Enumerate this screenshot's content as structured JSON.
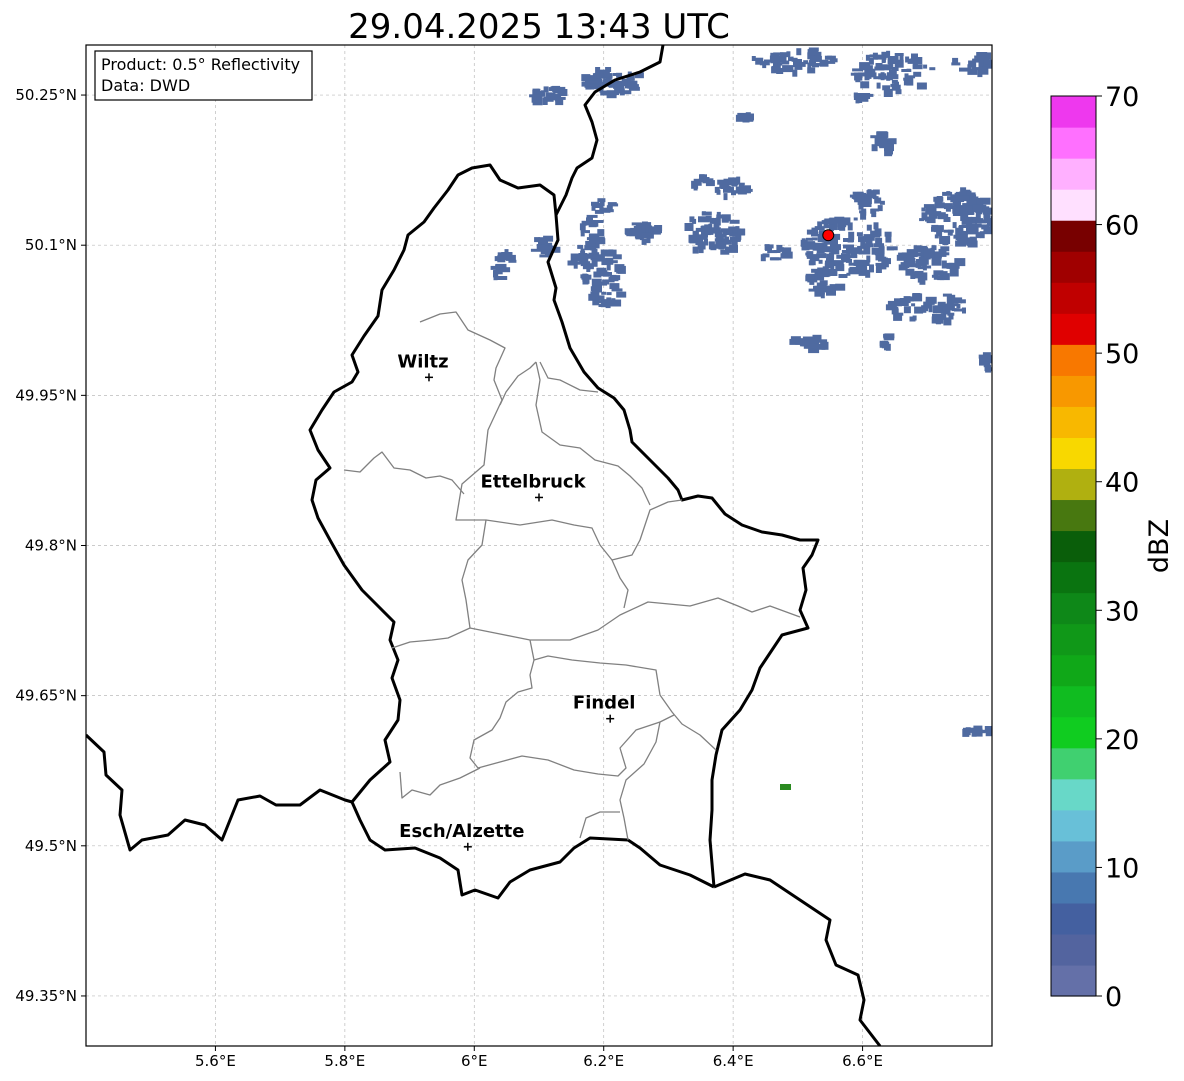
{
  "map": {
    "title": "29.04.2025 13:43 UTC",
    "info": {
      "line1": "Product: 0.5° Reflectivity",
      "line2": "Data: DWD"
    },
    "lon_range": [
      5.4,
      6.8
    ],
    "lat_range": [
      49.3,
      50.3
    ],
    "lon_ticks": [
      {
        "value": 5.6,
        "label": "5.6°E"
      },
      {
        "value": 5.8,
        "label": "5.8°E"
      },
      {
        "value": 6.0,
        "label": "6°E"
      },
      {
        "value": 6.2,
        "label": "6.2°E"
      },
      {
        "value": 6.4,
        "label": "6.4°E"
      },
      {
        "value": 6.6,
        "label": "6.6°E"
      }
    ],
    "lat_ticks": [
      {
        "value": 50.25,
        "label": "50.25°N"
      },
      {
        "value": 50.1,
        "label": "50.1°N"
      },
      {
        "value": 49.95,
        "label": "49.95°N"
      },
      {
        "value": 49.8,
        "label": "49.8°N"
      },
      {
        "value": 49.65,
        "label": "49.65°N"
      },
      {
        "value": 49.5,
        "label": "49.5°N"
      },
      {
        "value": 49.35,
        "label": "49.35°N"
      }
    ],
    "grid": true,
    "cities": [
      {
        "name": "Wiltz",
        "lon": 5.93,
        "lat": 49.968
      },
      {
        "name": "Ettelbruck",
        "lon": 6.1,
        "lat": 49.848
      },
      {
        "name": "Findel",
        "lon": 6.21,
        "lat": 49.627
      },
      {
        "name": "Esch/Alzette",
        "lon": 5.99,
        "lat": 49.499
      }
    ],
    "radar_site": {
      "lon": 6.547,
      "lat": 50.11,
      "color": "#ff0000"
    },
    "colors": {
      "border": "#000000",
      "canton": "#808080",
      "echo": "#4f6aa0",
      "grid": "#bbbbbb"
    }
  },
  "colorbar": {
    "label": "dBZ",
    "ticks": [
      "0",
      "10",
      "20",
      "30",
      "40",
      "50",
      "60",
      "70"
    ],
    "range": [
      0,
      70
    ],
    "colors": [
      "#6470a8",
      "#53649f",
      "#4460a0",
      "#4878b0",
      "#5a9cc8",
      "#68c0d8",
      "#68d8c8",
      "#40d070",
      "#10cc20",
      "#10bc20",
      "#10a818",
      "#109818",
      "#0e8818",
      "#0a7410",
      "#0a5e0a",
      "#487810",
      "#b0b010",
      "#f8d800",
      "#f8b800",
      "#f89800",
      "#f87800",
      "#e00000",
      "#c00000",
      "#a00000",
      "#780000",
      "#ffe0ff",
      "#ffb0ff",
      "#ff70ff",
      "#ee38ee"
    ]
  }
}
